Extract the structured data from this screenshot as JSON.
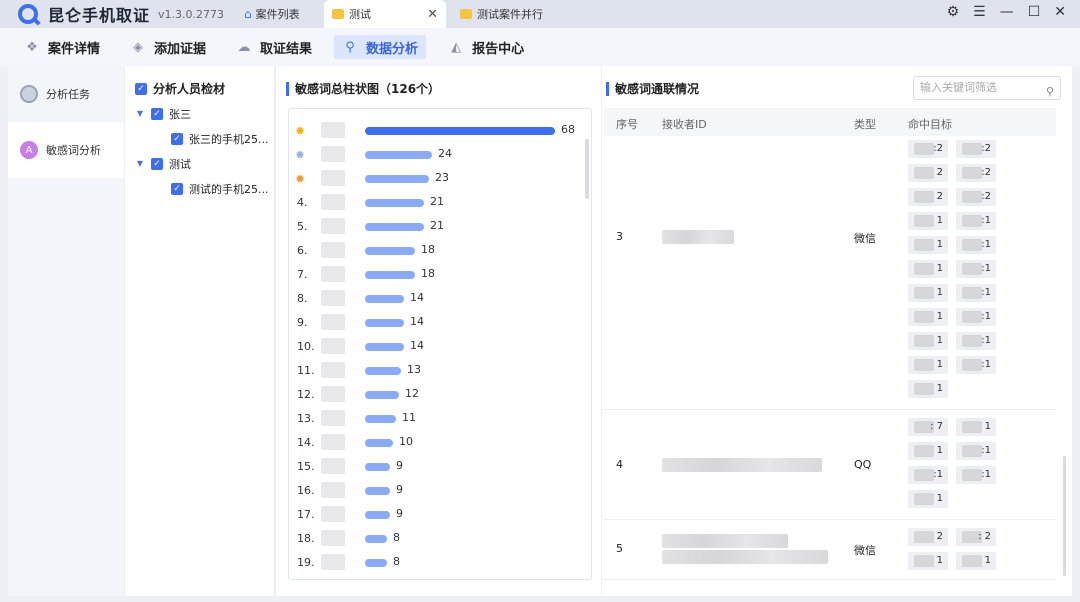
{
  "app": {
    "name": "昆仑手机取证",
    "version": "v1.3.0.2773"
  },
  "tabs": [
    {
      "label": "案件列表",
      "icon": "home-icon"
    },
    {
      "label": "测试",
      "icon": "folder-icon",
      "active": true
    },
    {
      "label": "测试案件并行",
      "icon": "folder-icon"
    }
  ],
  "toolbar": {
    "items": [
      {
        "label": "案件详情",
        "icon": "case-detail-icon"
      },
      {
        "label": "添加证据",
        "icon": "add-evidence-icon"
      },
      {
        "label": "取证结果",
        "icon": "result-icon"
      },
      {
        "label": "数据分析",
        "icon": "analysis-icon",
        "active": true
      },
      {
        "label": "报告中心",
        "icon": "report-icon"
      }
    ]
  },
  "leftnav": {
    "items": [
      {
        "label": "分析任务"
      },
      {
        "label": "敏感词分析",
        "active": true
      }
    ]
  },
  "tree": {
    "title": "分析人员检材",
    "groups": [
      {
        "name": "张三",
        "child": "张三的手机25..."
      },
      {
        "name": "测试",
        "child": "测试的手机25..."
      }
    ]
  },
  "chart_section": {
    "title": "敏感词总柱状图（126个）"
  },
  "chart_data": {
    "type": "bar",
    "title": "敏感词总柱状图（126个）",
    "orientation": "horizontal",
    "ranks": [
      "",
      "",
      "",
      "4.",
      "5.",
      "6.",
      "7.",
      "8.",
      "9.",
      "10.",
      "11.",
      "12.",
      "13.",
      "14.",
      "15.",
      "16.",
      "17.",
      "18.",
      "19."
    ],
    "values": [
      68,
      24,
      23,
      21,
      21,
      18,
      18,
      14,
      14,
      14,
      13,
      12,
      11,
      10,
      9,
      9,
      9,
      8,
      8
    ],
    "xlim": [
      0,
      68
    ],
    "top_color": "#3f6fe8",
    "bar_color": "#8aaaf3"
  },
  "right_section": {
    "title": "敏感词通联情况",
    "search_placeholder": "输入关键词筛选",
    "headers": [
      "序号",
      "接收者ID",
      "类型",
      "命中目标"
    ],
    "rows": [
      {
        "index": "3",
        "type": "微信",
        "tags": [
          ":2",
          ":2",
          "2",
          ":2",
          "2",
          ":2",
          "1",
          ":1",
          "1",
          ":1",
          "1",
          ":1",
          "1",
          ":1",
          "1",
          ":1",
          "1",
          ":1",
          "1",
          ":1",
          "1"
        ]
      },
      {
        "index": "4",
        "type": "QQ",
        "tags": [
          ": 7",
          "1",
          "1",
          ":1",
          ":1",
          ":1",
          "1"
        ]
      },
      {
        "index": "5",
        "type": "微信",
        "tags": [
          "2",
          ": 2",
          "1",
          "1"
        ]
      }
    ]
  }
}
